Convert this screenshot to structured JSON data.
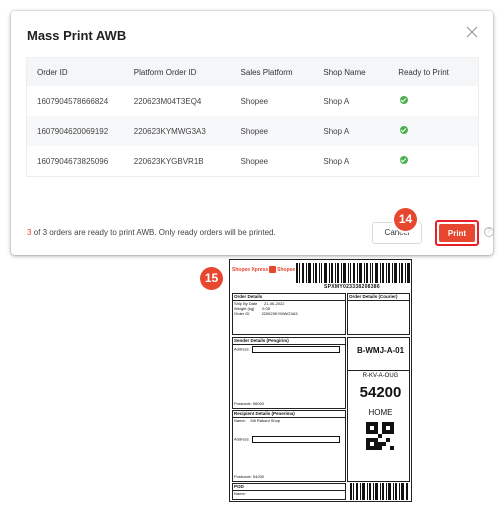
{
  "dialog": {
    "title": "Mass Print AWB",
    "close_icon": "close-icon",
    "columns": [
      "Order ID",
      "Platform Order ID",
      "Sales Platform",
      "Shop Name",
      "Ready to Print"
    ],
    "rows": [
      {
        "order_id": "1607904578666824",
        "platform_order_id": "220623M04T3EQ4",
        "sales_platform": "Shopee",
        "shop_name": "Shop A",
        "ready": true
      },
      {
        "order_id": "1607904620069192",
        "platform_order_id": "220623KYMWG3A3",
        "sales_platform": "Shopee",
        "shop_name": "Shop A",
        "ready": true
      },
      {
        "order_id": "1607904673825096",
        "platform_order_id": "220623KYGBVR1B",
        "sales_platform": "Shopee",
        "shop_name": "Shop A",
        "ready": true
      }
    ],
    "footer_count": "3",
    "footer_text": " of 3 orders are ready to print AWB. Only ready orders will be printed.",
    "cancel_label": "Cancel",
    "print_label": "Print",
    "help_icon": "?",
    "accent_color": "#e8472f",
    "ready_color": "#4cb050"
  },
  "badges": {
    "step_14": "14",
    "step_15": "15"
  },
  "awb": {
    "logo_text": "Shopee Xpress",
    "logo_brand": "Shopee",
    "tracking_no": "SPXMY023338208386",
    "order_details_title": "Order Details",
    "order_details_courier_title": "Order Details (Courier)",
    "ship_by_label": "Ship By Date",
    "ship_by_value": "21-06-2022",
    "weight_label": "Weight (kg)",
    "weight_value": "0.05",
    "order_id_label": "Order ID",
    "order_id_value": "220623KYMWG3A3",
    "sender_title": "Sender Details (Pengirim)",
    "address_label": "Address:",
    "sender_postcode": "Postcode: 56000",
    "recipient_title": "Recipient Details (Penerima)",
    "recipient_name_label": "Name:",
    "recipient_name_value": "Siti Rahani Shop",
    "recipient_postcode": "Postcode: 54200",
    "pod_title": "POD",
    "pod_name_label": "Name:",
    "route_code": "B-WMJ-A-01",
    "sort_code": "R-KV-A-OUG",
    "postcode_big": "54200",
    "delivery_type": "HOME"
  }
}
